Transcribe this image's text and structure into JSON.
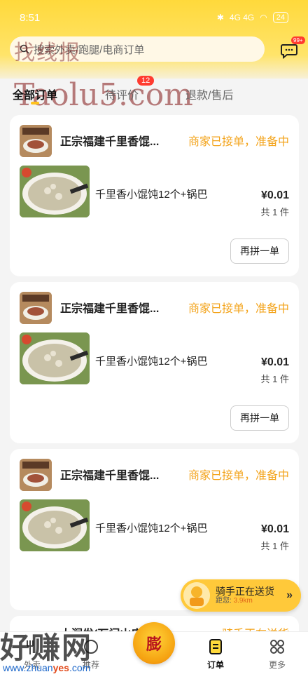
{
  "status_bar": {
    "time": "8:51",
    "indicators": "4G 4G",
    "battery": "24"
  },
  "search": {
    "placeholder": "搜索外卖/跑腿/电商订单"
  },
  "message": {
    "badge": "99+"
  },
  "watermarks": {
    "top": "找线报",
    "mid": "Taolu5.com",
    "bottom": "好赚网",
    "url_prefix": "www.zhuan",
    "url_highlight": "yes",
    "url_suffix": ".com"
  },
  "tabs": [
    {
      "label": "全部订单"
    },
    {
      "label": "待评价",
      "badge": "12"
    },
    {
      "label": "退款/售后"
    }
  ],
  "orders": [
    {
      "shop": "正宗福建千里香馄...",
      "status": "商家已接单，准备中",
      "item": "千里香小馄饨12个+锅巴",
      "price": "¥0.01",
      "qty": "共 1 件",
      "action": "再拼一单"
    },
    {
      "shop": "正宗福建千里香馄...",
      "status": "商家已接单，准备中",
      "item": "千里香小馄饨12个+锅巴",
      "price": "¥0.01",
      "qty": "共 1 件",
      "action": "再拼一单"
    },
    {
      "shop": "正宗福建千里香馄...",
      "status": "商家已接单，准备中",
      "item": "千里香小馄饨12个+锅巴",
      "price": "¥0.01",
      "qty": "共 1 件"
    },
    {
      "shop": "大润发(石门山店...",
      "status": "骑手正在送货"
    }
  ],
  "rider": {
    "title": "骑手正在送货",
    "dist_label": "距您:",
    "dist_value": "3.9km"
  },
  "nav": [
    {
      "label": "外卖"
    },
    {
      "label": "推荐"
    },
    {
      "label": "膨"
    },
    {
      "label": "订单"
    },
    {
      "label": "更多"
    }
  ],
  "colors": {
    "brand_yellow": "#ffd93b",
    "status_orange": "#f3a31a",
    "badge_red": "#ff3b30"
  }
}
